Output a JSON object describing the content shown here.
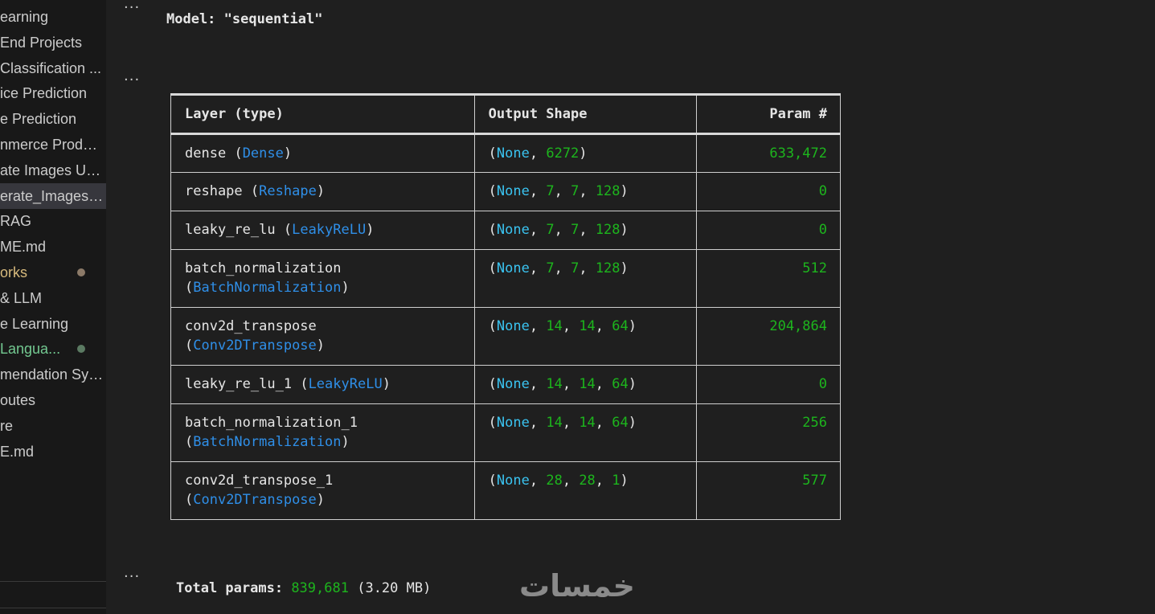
{
  "sidebar": {
    "items": [
      {
        "label": "earning",
        "state": "normal"
      },
      {
        "label": "End  Projects",
        "state": "normal"
      },
      {
        "label": "Classification ...",
        "state": "normal"
      },
      {
        "label": "ice Prediction",
        "state": "normal"
      },
      {
        "label": "e Prediction",
        "state": "normal"
      },
      {
        "label": "nmerce Produc...",
        "state": "normal"
      },
      {
        "label": "ate Images Usi...",
        "state": "normal"
      },
      {
        "label": "erate_Images_...",
        "state": "active"
      },
      {
        "label": "RAG",
        "state": "normal"
      },
      {
        "label": "ME.md",
        "state": "normal"
      },
      {
        "label": "orks",
        "state": "modified"
      },
      {
        "label": "& LLM",
        "state": "normal"
      },
      {
        "label": "e Learning",
        "state": "normal"
      },
      {
        "label": "Langua...",
        "state": "untracked"
      },
      {
        "label": "mendation Sys...",
        "state": "normal"
      },
      {
        "label": "outes",
        "state": "normal"
      },
      {
        "label": "re",
        "state": "normal"
      },
      {
        "label": "E.md",
        "state": "normal"
      }
    ]
  },
  "cells": {
    "ellipsis": "...",
    "model_label": "Model: \"sequential\""
  },
  "summary": {
    "headers": {
      "layer": "Layer (type)",
      "shape": "Output Shape",
      "params": "Param #"
    },
    "rows": [
      {
        "name": "dense",
        "type": "Dense",
        "wrap": false,
        "shape": [
          "None",
          "6272"
        ],
        "params": "633,472"
      },
      {
        "name": "reshape",
        "type": "Reshape",
        "wrap": false,
        "shape": [
          "None",
          "7",
          "7",
          "128"
        ],
        "params": "0"
      },
      {
        "name": "leaky_re_lu",
        "type": "LeakyReLU",
        "wrap": false,
        "shape": [
          "None",
          "7",
          "7",
          "128"
        ],
        "params": "0"
      },
      {
        "name": "batch_normalization",
        "type": "BatchNormalization",
        "wrap": true,
        "shape": [
          "None",
          "7",
          "7",
          "128"
        ],
        "params": "512"
      },
      {
        "name": "conv2d_transpose",
        "type": "Conv2DTranspose",
        "wrap": true,
        "shape": [
          "None",
          "14",
          "14",
          "64"
        ],
        "params": "204,864"
      },
      {
        "name": "leaky_re_lu_1",
        "type": "LeakyReLU",
        "wrap": false,
        "shape": [
          "None",
          "14",
          "14",
          "64"
        ],
        "params": "0"
      },
      {
        "name": "batch_normalization_1",
        "type": "BatchNormalization",
        "wrap": true,
        "shape": [
          "None",
          "14",
          "14",
          "64"
        ],
        "params": "256"
      },
      {
        "name": "conv2d_transpose_1",
        "type": "Conv2DTranspose",
        "wrap": true,
        "shape": [
          "None",
          "28",
          "28",
          "1"
        ],
        "params": "577"
      }
    ]
  },
  "totals": {
    "label": "Total params:",
    "value": "839,681",
    "size": "(3.20 MB)"
  },
  "watermark": {
    "text": "خمسات",
    "color": "#8a8a8a"
  },
  "colors": {
    "class_name": "#2f8fe8",
    "none_keyword": "#3ac3f0",
    "number": "#1db51d",
    "modified_dot": "#8c7a68",
    "untracked_dot": "#5b7a62"
  }
}
